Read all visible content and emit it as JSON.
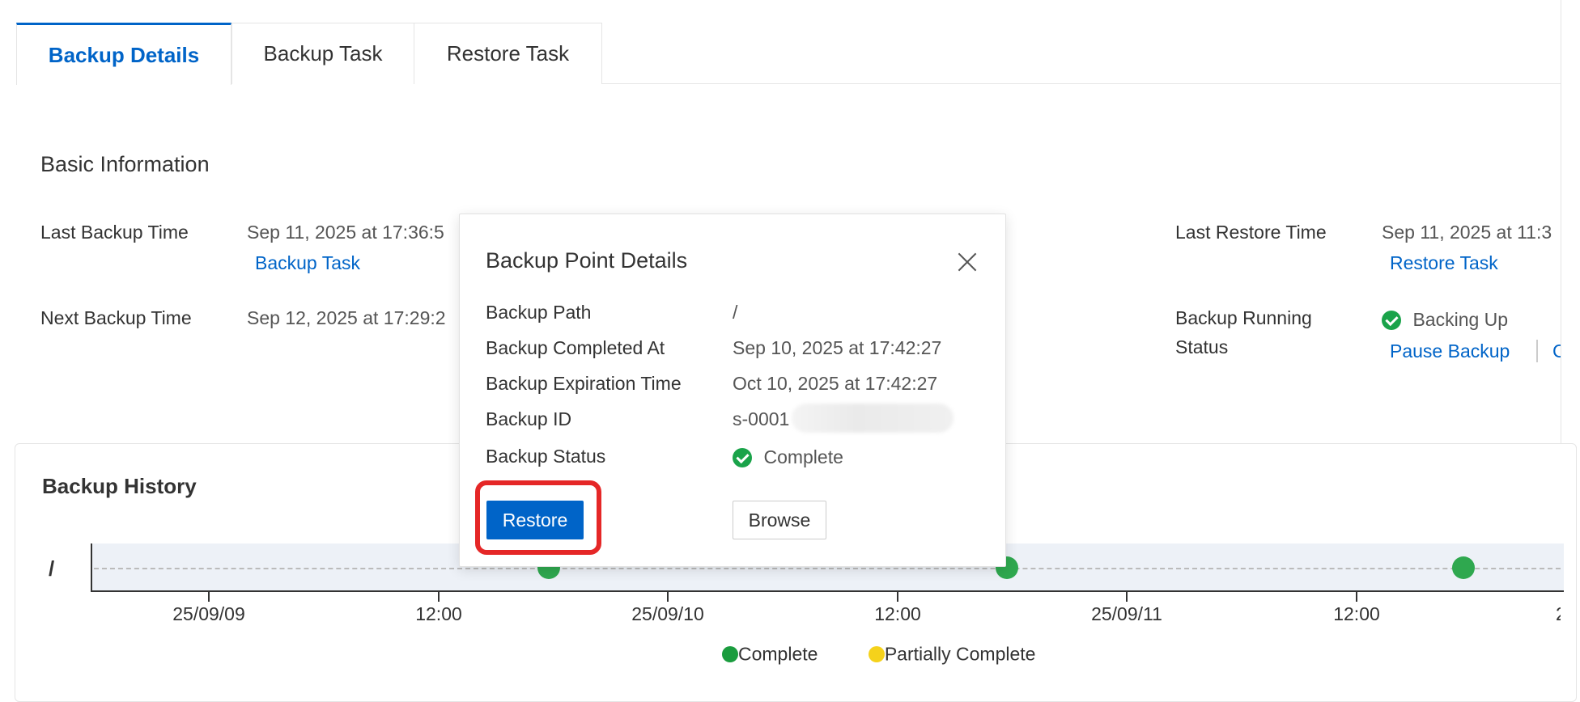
{
  "tabs": [
    {
      "label": "Backup Details",
      "active": true
    },
    {
      "label": "Backup Task",
      "active": false
    },
    {
      "label": "Restore Task",
      "active": false
    }
  ],
  "basic_info": {
    "title": "Basic Information",
    "last_backup_time_label": "Last Backup Time",
    "last_backup_time_value": "Sep 11, 2025 at 17:36:5",
    "backup_task_link": "Backup Task",
    "next_backup_time_label": "Next Backup Time",
    "next_backup_time_value": "Sep 12, 2025 at 17:29:2",
    "last_restore_time_label": "Last Restore Time",
    "last_restore_time_value": "Sep 11, 2025 at 11:3",
    "restore_task_link": "Restore Task",
    "backup_running_status_label_line1": "Backup Running",
    "backup_running_status_label_line2": "Status",
    "backup_running_status_value": "Backing Up",
    "pause_backup_link": "Pause Backup",
    "truncated_link": "C"
  },
  "history": {
    "title": "Backup History",
    "row_label": "/",
    "axis_labels": [
      "25/09/09",
      "12:00",
      "25/09/10",
      "12:00",
      "25/09/11",
      "12:00",
      "2"
    ],
    "points_status": [
      "Complete",
      "Complete",
      "Complete"
    ],
    "legend": [
      {
        "label": "Complete",
        "color": "#1a9c3e"
      },
      {
        "label": "Partially Complete",
        "color": "#f5d21b"
      }
    ]
  },
  "modal": {
    "title": "Backup Point Details",
    "rows": [
      {
        "label": "Backup Path",
        "value": "/"
      },
      {
        "label": "Backup Completed At",
        "value": "Sep 10, 2025 at 17:42:27"
      },
      {
        "label": "Backup Expiration Time",
        "value": "Oct 10, 2025 at 17:42:27"
      },
      {
        "label": "Backup ID",
        "value": "s-0001"
      },
      {
        "label": "Backup Status",
        "value": "Complete"
      }
    ],
    "restore_button": "Restore",
    "browse_button": "Browse"
  },
  "colors": {
    "accent": "#0064c8",
    "success": "#1aa34a",
    "highlight": "#e52727"
  }
}
